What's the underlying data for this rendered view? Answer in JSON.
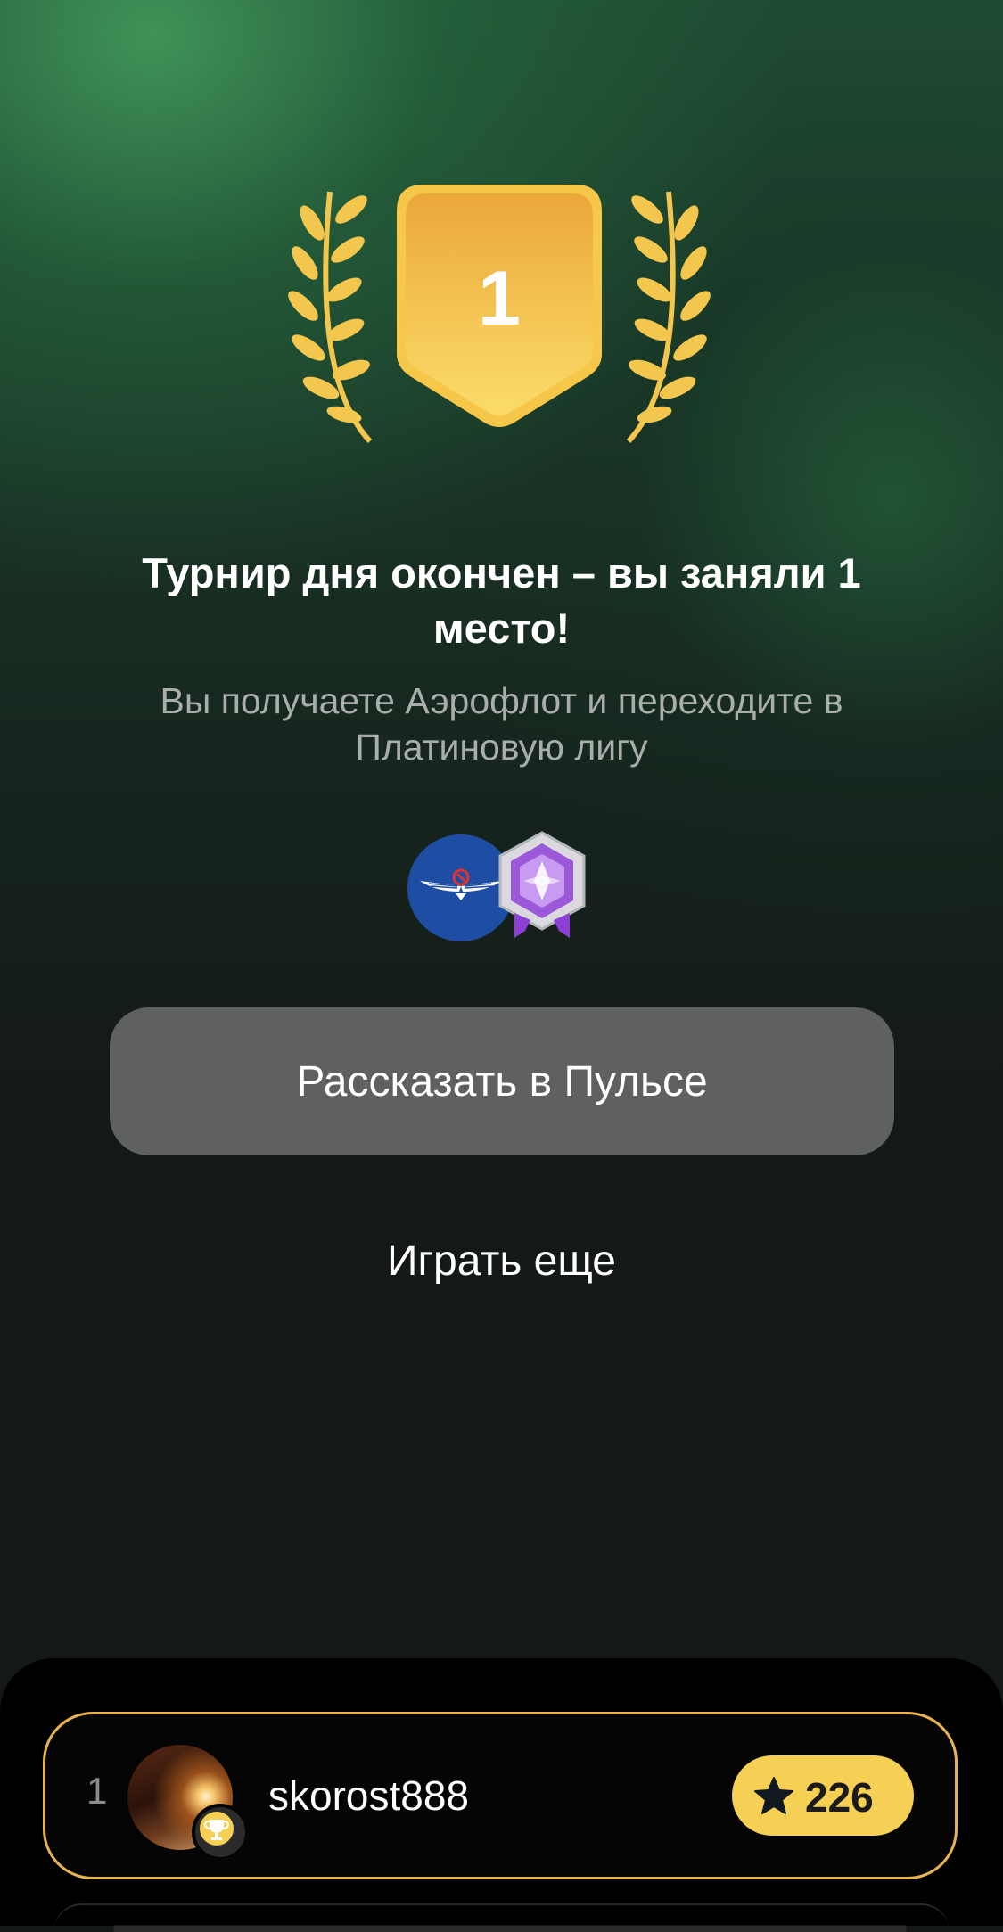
{
  "result": {
    "place_number": "1",
    "title": "Турнир дня окончен – вы заняли 1 место!",
    "subtitle": "Вы получаете Аэрофлот и переходите в Платиновую лигу"
  },
  "rewards": {
    "airline_icon": "aeroflot-logo",
    "league_icon": "platinum-league-badge"
  },
  "actions": {
    "share_label": "Рассказать в Пульсе",
    "play_again_label": "Играть еще"
  },
  "leaderboard": {
    "rows": [
      {
        "rank": "1",
        "username": "skorost888",
        "score": "226",
        "score_icon": "star-icon",
        "badge_icon": "trophy-icon"
      }
    ]
  },
  "colors": {
    "accent_gold": "#f6cf55",
    "button_gray": "#5e615f",
    "background_green": "#1e4a32",
    "airline_blue": "#1e4ea3"
  }
}
